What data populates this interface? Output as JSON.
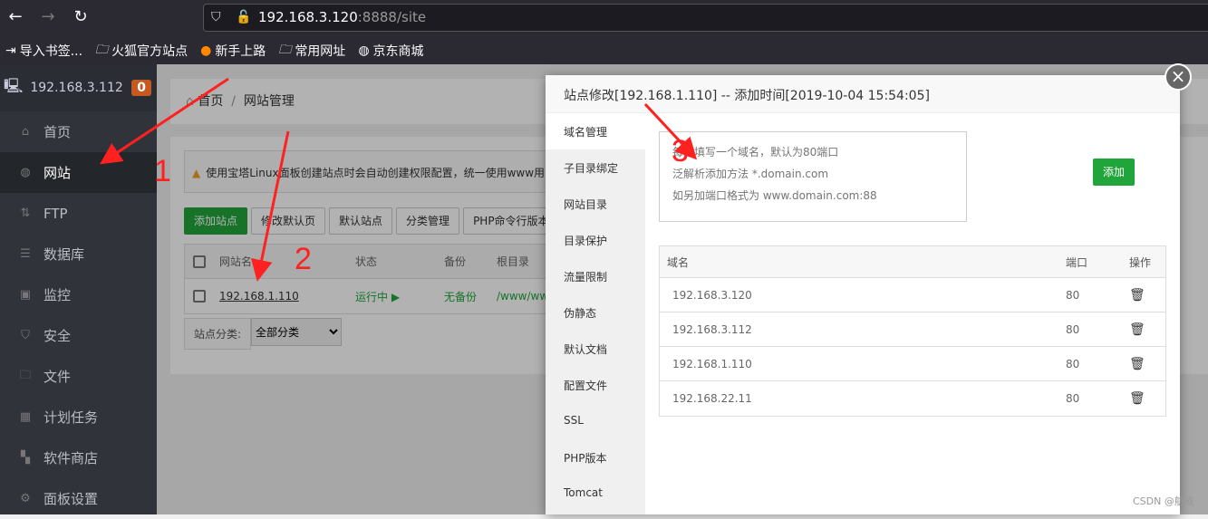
{
  "browser": {
    "url_host": "192.168.3.120",
    "url_path": ":8888/site",
    "bookmarks": [
      {
        "icon": "import-icon",
        "label": "导入书签..."
      },
      {
        "icon": "folder-icon",
        "label": "火狐官方站点"
      },
      {
        "icon": "firefox-icon",
        "label": "新手上路"
      },
      {
        "icon": "folder-icon",
        "label": "常用网址"
      },
      {
        "icon": "globe-icon",
        "label": "京东商城"
      }
    ]
  },
  "sidebar": {
    "host": "192.168.3.112",
    "badge": "0",
    "items": [
      {
        "label": "首页",
        "icon": "home-icon"
      },
      {
        "label": "网站",
        "icon": "globe-icon",
        "active": true
      },
      {
        "label": "FTP",
        "icon": "ftp-icon"
      },
      {
        "label": "数据库",
        "icon": "database-icon"
      },
      {
        "label": "监控",
        "icon": "monitor-icon"
      },
      {
        "label": "安全",
        "icon": "shield-icon"
      },
      {
        "label": "文件",
        "icon": "folder-icon"
      },
      {
        "label": "计划任务",
        "icon": "calendar-icon"
      },
      {
        "label": "软件商店",
        "icon": "apps-icon"
      },
      {
        "label": "面板设置",
        "icon": "gear-icon"
      }
    ]
  },
  "breadcrumb": {
    "home": "首页",
    "sep": "/",
    "current": "网站管理"
  },
  "alert": "使用宝塔Linux面板创建站点时会自动创建权限配置，统一使用www用",
  "toolbar": [
    "添加站点",
    "修改默认页",
    "默认站点",
    "分类管理",
    "PHP命令行版本"
  ],
  "site_table": {
    "headers": [
      "网站名",
      "状态",
      "备份",
      "根目录"
    ],
    "rows": [
      {
        "name": "192.168.1.110",
        "status": "运行中 ▶",
        "backup": "无备份",
        "root": "/www/www"
      }
    ]
  },
  "filter": {
    "label": "站点分类:",
    "value": "全部分类"
  },
  "modal": {
    "title": "站点修改[192.168.1.110] -- 添加时间[2019-10-04 15:54:05]",
    "close": "×",
    "tabs": [
      "域名管理",
      "子目录绑定",
      "网站目录",
      "目录保护",
      "流量限制",
      "伪静态",
      "默认文档",
      "配置文件",
      "SSL",
      "PHP版本",
      "Tomcat"
    ],
    "placeholder": "每行填写一个域名，默认为80端口\n泛解析添加方法 *.domain.com\n如另加端口格式为 www.domain.com:88",
    "add": "添加",
    "domain_table": {
      "headers": [
        "域名",
        "端口",
        "操作"
      ],
      "rows": [
        {
          "domain": "192.168.3.120",
          "port": "80"
        },
        {
          "domain": "192.168.3.112",
          "port": "80"
        },
        {
          "domain": "192.168.1.110",
          "port": "80"
        },
        {
          "domain": "192.168.22.11",
          "port": "80"
        }
      ]
    }
  },
  "annotations": [
    "1",
    "2",
    "3"
  ],
  "watermark": "CSDN @航成",
  "colors": {
    "accent": "#20a53a",
    "annotation": "#ff2020"
  }
}
